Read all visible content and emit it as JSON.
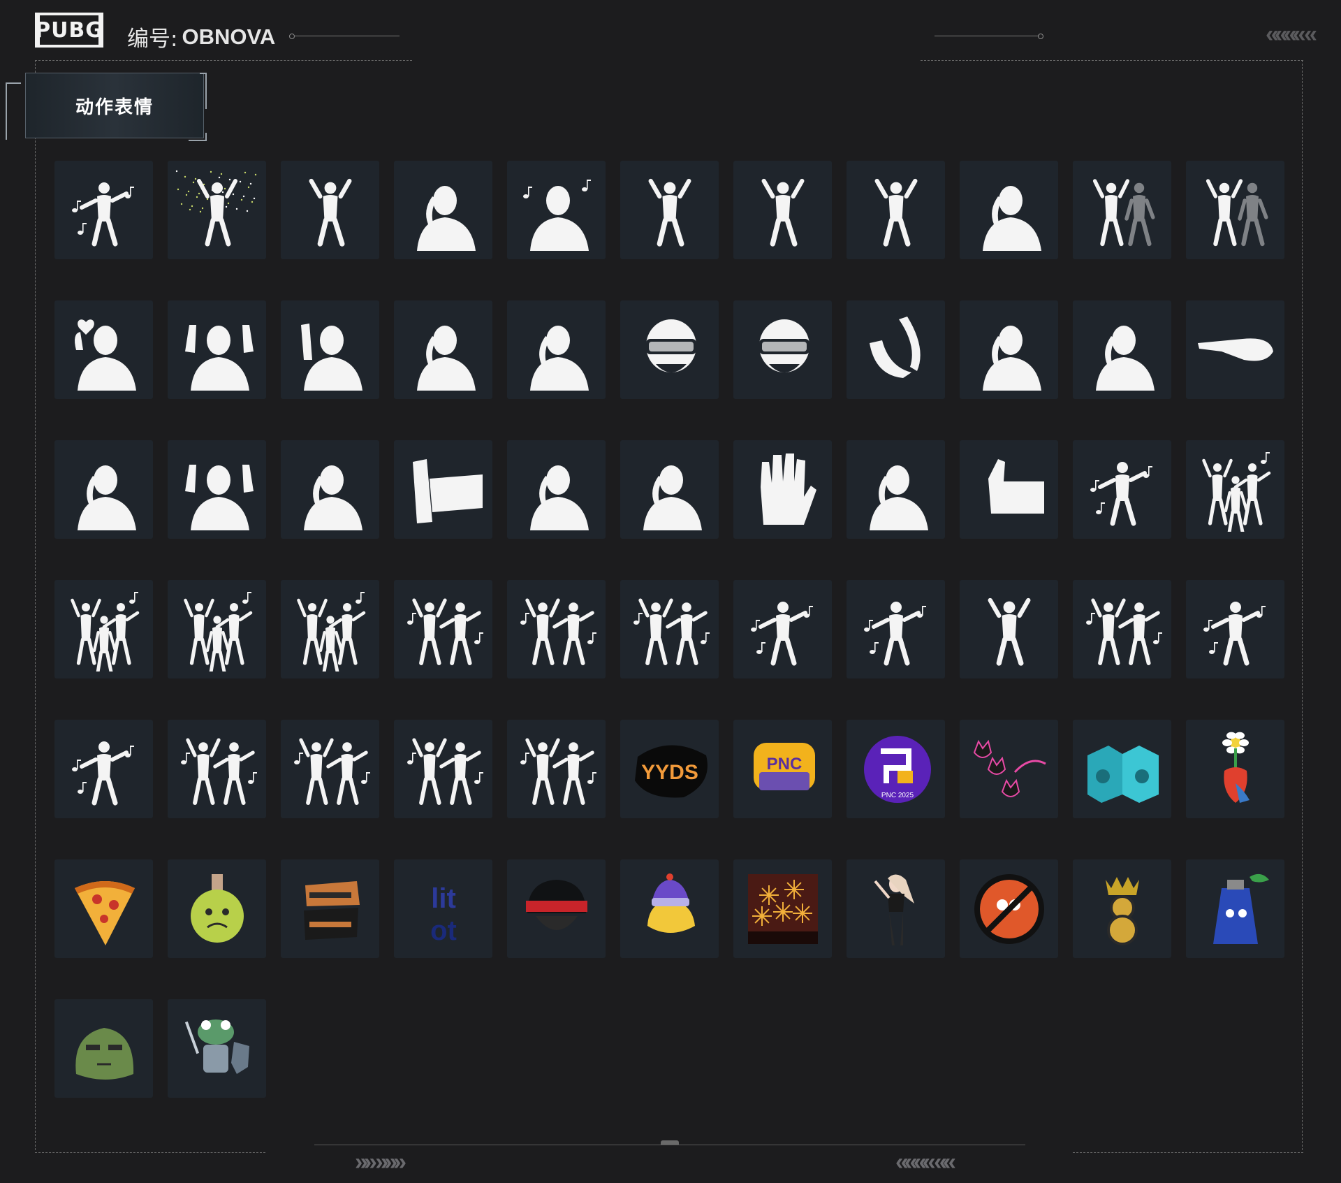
{
  "header": {
    "logo": "PUBG",
    "id_prefix": "编号:",
    "id_value": "OBNOVA"
  },
  "tab": {
    "label": "动作表情"
  },
  "colors": {
    "background": "#1c1c1e",
    "tile": "#1f252c",
    "silhouette": "#f4f4f4"
  },
  "emotes": [
    {
      "icon": "kneeling-dance-emote-icon",
      "kind": "music-pose"
    },
    {
      "icon": "sparkle-celebrate-emote-icon",
      "kind": "sparkle"
    },
    {
      "icon": "lunge-dance-emote-icon",
      "kind": "pose"
    },
    {
      "icon": "headache-emote-icon",
      "kind": "bust"
    },
    {
      "icon": "tea-drinking-emote-icon",
      "kind": "music-bust"
    },
    {
      "icon": "hopping-emote-icon",
      "kind": "pose"
    },
    {
      "icon": "squat-prayer-emote-icon",
      "kind": "pose"
    },
    {
      "icon": "bent-over-emote-icon",
      "kind": "pose"
    },
    {
      "icon": "pointing-at-you-emote-icon",
      "kind": "bust"
    },
    {
      "icon": "jumping-duo-emote-icon",
      "kind": "duo"
    },
    {
      "icon": "push-duo-emote-icon",
      "kind": "duo"
    },
    {
      "icon": "heart-hands-emote-icon",
      "kind": "bust-heart"
    },
    {
      "icon": "hands-up-emote-icon",
      "kind": "bust-hands"
    },
    {
      "icon": "wave-emote-icon",
      "kind": "bust-wave"
    },
    {
      "icon": "shrug-off-emote-icon",
      "kind": "bust"
    },
    {
      "icon": "lean-on-arm-emote-icon",
      "kind": "bust"
    },
    {
      "icon": "angry-helmet-emote-icon",
      "kind": "helmet"
    },
    {
      "icon": "laughing-helmet-emote-icon",
      "kind": "helmet"
    },
    {
      "icon": "clapping-hands-emote-icon",
      "kind": "hands"
    },
    {
      "icon": "facepalm-emote-icon",
      "kind": "bust"
    },
    {
      "icon": "dizzy-emote-icon",
      "kind": "bust"
    },
    {
      "icon": "point-finger-emote-icon",
      "kind": "finger"
    },
    {
      "icon": "beckon-emote-icon",
      "kind": "bust"
    },
    {
      "icon": "shrug-emote-icon",
      "kind": "bust-hands"
    },
    {
      "icon": "arms-crossed-turn-emote-icon",
      "kind": "bust"
    },
    {
      "icon": "punch-emote-icon",
      "kind": "fist"
    },
    {
      "icon": "cry-emote-icon",
      "kind": "bust"
    },
    {
      "icon": "sigh-emote-icon",
      "kind": "bust"
    },
    {
      "icon": "stop-hand-emote-icon",
      "kind": "palm"
    },
    {
      "icon": "arms-crossed-emote-icon",
      "kind": "bust"
    },
    {
      "icon": "thumbs-up-emote-icon",
      "kind": "thumb"
    },
    {
      "icon": "disco-point-emote-icon",
      "kind": "music-pose"
    },
    {
      "icon": "group-dance-emote-icon",
      "kind": "group"
    },
    {
      "icon": "kpop-dance-1-emote-icon",
      "kind": "group"
    },
    {
      "icon": "kpop-dance-2-emote-icon",
      "kind": "group"
    },
    {
      "icon": "kpop-dance-3-emote-icon",
      "kind": "group"
    },
    {
      "icon": "duo-dance-1-emote-icon",
      "kind": "music-duo"
    },
    {
      "icon": "duo-kick-emote-icon",
      "kind": "music-duo"
    },
    {
      "icon": "duo-dance-2-emote-icon",
      "kind": "music-duo"
    },
    {
      "icon": "cartwheel-emote-icon",
      "kind": "music-pose"
    },
    {
      "icon": "confident-dance-emote-icon",
      "kind": "music-pose"
    },
    {
      "icon": "star-jump-emote-icon",
      "kind": "pose"
    },
    {
      "icon": "duo-dance-3-emote-icon",
      "kind": "music-duo"
    },
    {
      "icon": "groove-emote-icon",
      "kind": "music-pose"
    },
    {
      "icon": "moonwalk-emote-icon",
      "kind": "music-pose"
    },
    {
      "icon": "duo-dance-4-emote-icon",
      "kind": "music-duo"
    },
    {
      "icon": "duo-dance-5-emote-icon",
      "kind": "music-duo"
    },
    {
      "icon": "duo-dance-6-emote-icon",
      "kind": "music-duo"
    },
    {
      "icon": "duo-dance-7-emote-icon",
      "kind": "music-duo"
    },
    {
      "icon": "yyds-sticker-icon",
      "kind": "yyds",
      "label": "YYDS"
    },
    {
      "icon": "pnc-2025-badge-icon",
      "kind": "pnc-gold",
      "label": "PNC"
    },
    {
      "icon": "pnc-2025-logo-icon",
      "kind": "pnc-purple",
      "label": "PNC 2025"
    },
    {
      "icon": "neon-cats-sticker-icon",
      "kind": "neon"
    },
    {
      "icon": "speaker-boxes-sticker-icon",
      "kind": "boxes"
    },
    {
      "icon": "flower-heart-sticker-icon",
      "kind": "flower"
    },
    {
      "icon": "pizza-slice-sticker-icon",
      "kind": "pizza"
    },
    {
      "icon": "potion-bottle-sticker-icon",
      "kind": "potion"
    },
    {
      "icon": "letter-s-badge-icon",
      "kind": "s-badge"
    },
    {
      "icon": "lit-badge-icon",
      "kind": "lit"
    },
    {
      "icon": "horned-helmet-sticker-icon",
      "kind": "dark-helmet"
    },
    {
      "icon": "helmet-chick-sticker-icon",
      "kind": "chick"
    },
    {
      "icon": "fireworks-sticker-icon",
      "kind": "fireworks"
    },
    {
      "icon": "girl-character-sticker-icon",
      "kind": "girl"
    },
    {
      "icon": "no-chicken-sticker-icon",
      "kind": "no-chicken"
    },
    {
      "icon": "crowned-eight-sticker-icon",
      "kind": "eight"
    },
    {
      "icon": "spray-can-sticker-icon",
      "kind": "spray"
    },
    {
      "icon": "grumpy-blob-sticker-icon",
      "kind": "blob"
    },
    {
      "icon": "frog-knight-sticker-icon",
      "kind": "frog"
    }
  ]
}
